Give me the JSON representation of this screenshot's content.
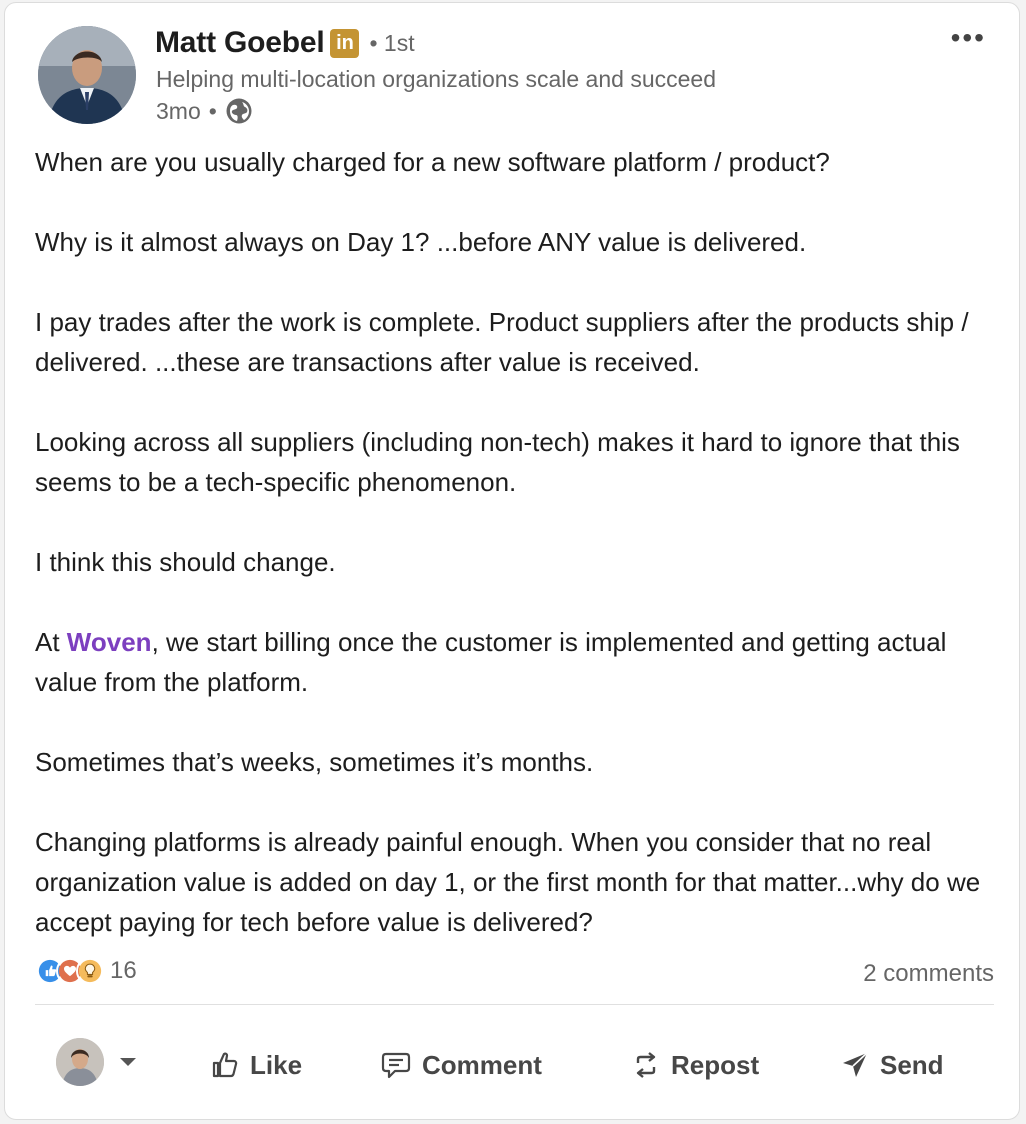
{
  "post": {
    "author": {
      "name": "Matt Goebel",
      "connection": "• 1st",
      "headline": "Helping multi-location organizations scale and succeed",
      "age": "3mo",
      "visibility_icon": "globe-icon"
    },
    "more_icon": "•••",
    "body": {
      "p1": "When are you usually charged for a new software platform / product?",
      "p2": "Why is it almost always on Day 1? ...before ANY value is delivered.",
      "p3": "I pay trades after the work is complete. Product suppliers after the products ship / delivered. ...these are transactions after value is received.",
      "p4": "Looking across all suppliers (including non-tech) makes it hard to ignore that this seems to be a tech-specific phenomenon.",
      "p5": "I think this should change.",
      "p6_before": "At ",
      "p6_mention": "Woven",
      "p6_after": ", we start billing once the customer is implemented and getting actual value from the platform.",
      "p7": "Sometimes that’s weeks, sometimes it’s months.",
      "p8": "Changing platforms is already painful enough. When you consider that no real organization value is added on day 1, or the first month for that matter...why do we accept paying for tech before value is delivered?"
    },
    "reactions": {
      "count": "16",
      "icons": [
        "like-reaction-icon",
        "love-reaction-icon",
        "insightful-reaction-icon"
      ]
    },
    "comments": "2 comments",
    "actions": {
      "like": "Like",
      "comment": "Comment",
      "repost": "Repost",
      "send": "Send"
    },
    "colors": {
      "mention": "#7c3fbf",
      "linkedin_badge": "#c49433",
      "text": "#1d1d1d",
      "muted": "#666666"
    }
  }
}
